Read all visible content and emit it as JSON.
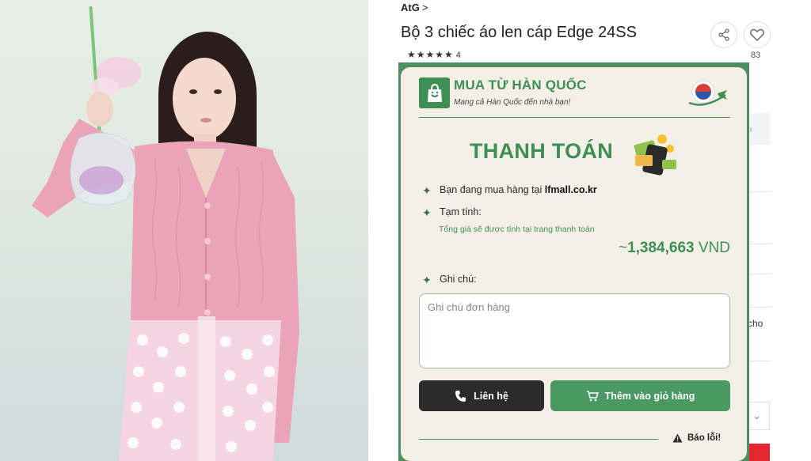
{
  "product": {
    "brand": "AtG",
    "brand_chevron": ">",
    "title": "Bộ 3 chiếc áo len cáp Edge 24SS",
    "stars": "★★★★★",
    "rating_count": "4",
    "like_count": "83"
  },
  "background": {
    "fragment_text": "cho",
    "select_chevron": "⌄"
  },
  "panel": {
    "title": "MUA TỪ HÀN QUỐC",
    "subtitle": "Mang cả Hàn Quốc đến nhà bạn!",
    "heading": "THANH TOÁN",
    "shopping_at_label": "Bạn đang mua hàng tại",
    "shopping_at_site": "lfmall.co.kr",
    "subtotal_label": "Tạm tính:",
    "subtotal_note": "Tổng giá sẽ được tính tại trang thanh toán",
    "price_prefix": "~",
    "price_value": "1,384,663",
    "price_currency": "VND",
    "note_label": "Ghi chú:",
    "note_placeholder": "Ghi chú đơn hàng",
    "contact_button": "Liên hệ",
    "cart_button": "Thêm vào giỏ hàng",
    "report_label": "Báo lỗi!",
    "star_glyph": "✦"
  },
  "colors": {
    "brand_green": "#3e8f55",
    "panel_border": "#4d8f5e",
    "panel_bg": "#f4efe7",
    "contact_bg": "#2b2b2b",
    "cart_bg": "#4a9862"
  }
}
